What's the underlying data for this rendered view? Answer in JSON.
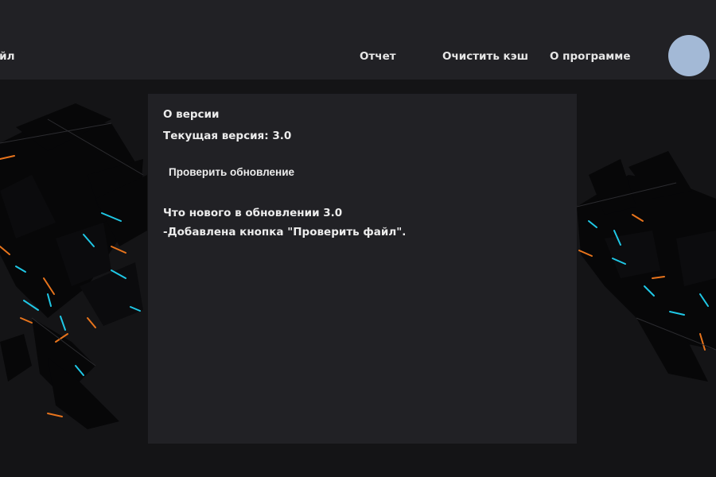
{
  "nav": {
    "left_partial": "айл",
    "report": "Отчет",
    "clear_cache": "Очистить кэш",
    "about": "О программе"
  },
  "colors": {
    "topbar": "#212125",
    "panel": "#212125",
    "background": "#141416",
    "avatar": "#a3b9d6",
    "accent_cyan": "#1fc8e6",
    "accent_orange": "#e8741c"
  },
  "about": {
    "title": "О версии",
    "current_version_label": "Текущая версия: 3.0",
    "check_update_button": "Проверить обновление",
    "whats_new_title": "Что нового в обновлении 3.0",
    "whats_new_items": [
      "-Добавлена кнопка \"Проверить файл\"."
    ]
  }
}
